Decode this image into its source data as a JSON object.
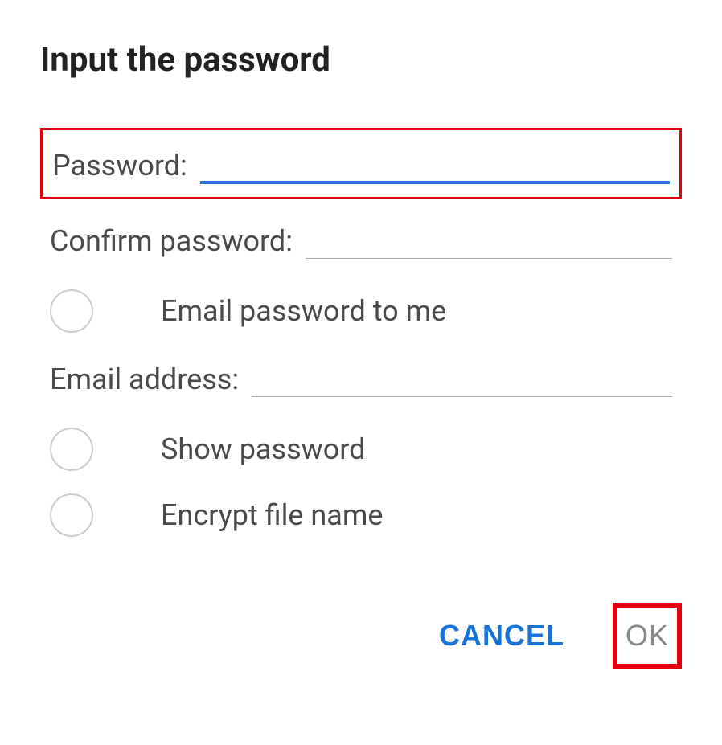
{
  "dialog": {
    "title": "Input the password",
    "password_label": "Password:",
    "confirm_password_label": "Confirm password:",
    "email_checkbox_label": "Email password to me",
    "email_address_label": "Email address:",
    "show_password_label": "Show password",
    "encrypt_filename_label": "Encrypt file name",
    "cancel_button": "CANCEL",
    "ok_button": "OK"
  }
}
